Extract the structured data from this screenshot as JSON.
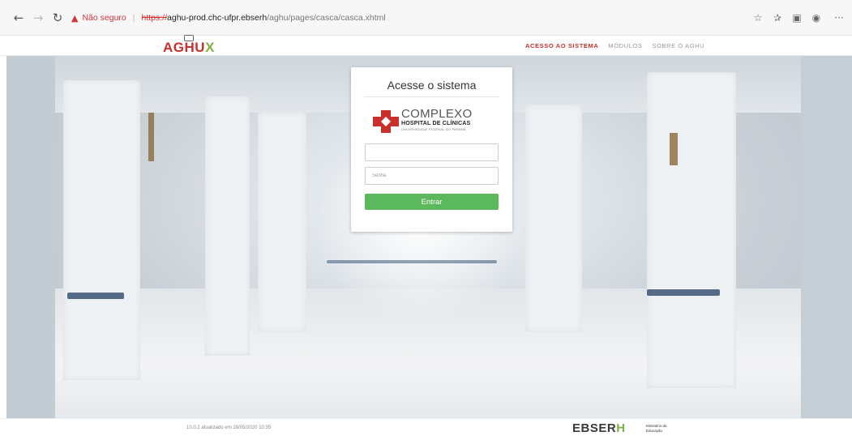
{
  "browser": {
    "security_warning_text": "Não seguro",
    "separator": "|",
    "url_protocol": "https://",
    "url_host": "aghu-prod.chc-ufpr.ebserh",
    "url_path": "/aghu/pages/casca/casca.xhtml",
    "icons": [
      "back-arrow-icon",
      "forward-arrow-icon",
      "refresh-icon",
      "warning-triangle-icon",
      "favorite-star-icon",
      "favorites-bar-icon",
      "collections-icon",
      "profile-icon",
      "more-icon"
    ],
    "warning_color": "#d13438"
  },
  "site": {
    "logo_main": "AGHU",
    "logo_accent": "X",
    "menu": {
      "access": "ACESSO AO SISTEMA",
      "modules": "MÓDULOS",
      "about": "SOBRE O AGHU"
    },
    "brand_red": "#c9302c",
    "brand_green": "#7cb342"
  },
  "login": {
    "title": "Acesse o sistema",
    "institution": {
      "line1": "COMPLEXO",
      "line2": "HOSPITAL DE CLÍNICAS",
      "line3": "UNIVERSIDADE FEDERAL DO PARANÁ"
    },
    "username_value": "",
    "password_placeholder": "Senha",
    "submit_label": "Entrar",
    "button_color": "#5cb85c"
  },
  "footer": {
    "version": "10.0.2 atualizado em 28/05/2020 10:35",
    "ebserh_main": "EBSER",
    "ebserh_accent": "H",
    "ministry_line1": "Ministério da",
    "ministry_line2": "Educação"
  }
}
